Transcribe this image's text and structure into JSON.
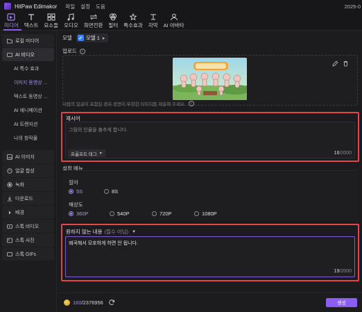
{
  "titlebar": {
    "app_name": "HitPaw Edimakor",
    "menus": [
      "파일",
      "설정",
      "도움"
    ],
    "right_text": "2025-0"
  },
  "toolbar": {
    "tools": [
      {
        "label": "미디어",
        "icon": "media-icon",
        "active": true
      },
      {
        "label": "텍스트",
        "icon": "text-icon"
      },
      {
        "label": "요소들",
        "icon": "elements-icon"
      },
      {
        "label": "오디오",
        "icon": "audio-icon"
      },
      {
        "label": "화면전환",
        "icon": "transition-icon"
      },
      {
        "label": "필터",
        "icon": "filter-icon"
      },
      {
        "label": "특수효과",
        "icon": "effects-icon"
      },
      {
        "label": "자막",
        "icon": "subtitle-icon"
      },
      {
        "label": "AI 아바타",
        "icon": "ai-avatar-icon"
      }
    ]
  },
  "sidebar": {
    "local_media": "로컬 미디어",
    "ai_video": "AI 비디오",
    "sub_items": [
      "AI 특수 효과",
      "이미지 동영상 ...",
      "텍스트 동영상 ...",
      "AI 애니메이션",
      "AI 트랜지션",
      "나의 창작물"
    ],
    "selected_sub": "이미지 동영상 ...",
    "lower_items": [
      "AI 이미지",
      "얼굴 합성",
      "녹화",
      "다운로드",
      "배경",
      "스톡 비디오",
      "스톡 사진",
      "스톡 GIFs"
    ]
  },
  "main": {
    "model_label": "모델",
    "model_badge": "✓",
    "model_value": "모델 1",
    "upload_label": "업로드",
    "upload_note": "사람의 얼굴이 포함된 경우 정면이 뚜렷한 이미지를 제출해 주세요.",
    "prompt": {
      "label": "제시어",
      "placeholder": "그림의 인물을 춤추게 합니다.",
      "tag_button": "프롬프트 태그",
      "count": "16",
      "max": "/2000"
    },
    "settings": {
      "label": "설정 메뉴",
      "length_label": "길이",
      "length_options": [
        "5S",
        "8S"
      ],
      "length_selected": "5S",
      "resolution_label": "해상도",
      "resolution_options": [
        "360P",
        "540P",
        "720P",
        "1080P"
      ],
      "resolution_selected": "360P"
    },
    "negative": {
      "label": "원하지 않는 내용",
      "optional": "(필수 아님)",
      "value": "왜곡해서 모호하게 하면 안 됩니다.",
      "count": "19",
      "max": "/2000"
    }
  },
  "footer": {
    "credits_used": "160",
    "credits_total": "/2376956",
    "generate_label": "생성"
  },
  "colors": {
    "accent": "#8b5cf6",
    "highlight_border": "#e04848",
    "background": "#1c1c1e"
  }
}
